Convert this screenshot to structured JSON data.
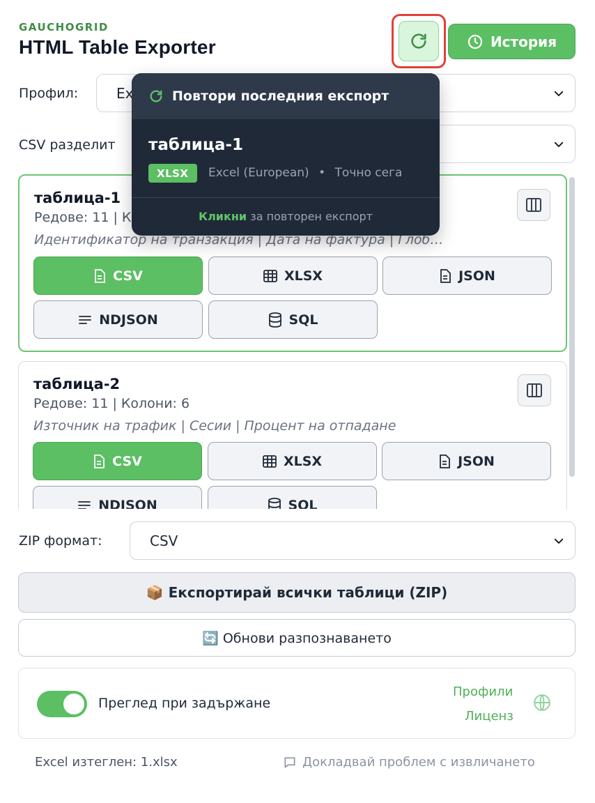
{
  "header": {
    "brand": "GAUCHOGRID",
    "title": "HTML Table Exporter",
    "history_label": "История"
  },
  "form": {
    "profile_label": "Профил:",
    "profile_value": "Ex",
    "csv_sep_label": "CSV разделит"
  },
  "tables": [
    {
      "name": "таблица-1",
      "meta": "Редове: 11 | К",
      "columns": "Идентификатор на транзакция | Дата на фактура | Глоб…"
    },
    {
      "name": "таблица-2",
      "meta": "Редове: 11 | Колони: 6",
      "columns": "Източник на трафик | Сесии | Процент на отпадане"
    }
  ],
  "formats": {
    "csv": "CSV",
    "xlsx": "XLSX",
    "json": "JSON",
    "ndjson": "NDJSON",
    "sql": "SQL"
  },
  "zip": {
    "label": "ZIP формат:",
    "value": "CSV",
    "export_all": "📦 Експортирай всички таблици (ZIP)"
  },
  "refresh_detection": "🔄 Обнови разпознаването",
  "settings": {
    "hover_preview": "Преглед при задържане",
    "hover_preview_enabled": true,
    "profiles_link": "Профили",
    "license_link": "Лиценз"
  },
  "footer": {
    "last_download": "Excel изтеглен: 1.xlsx",
    "report_issue": "Докладвай проблем с извличането"
  },
  "popover": {
    "title": "Повтори последния експорт",
    "table_name": "таблица-1",
    "format_badge": "XLSX",
    "format_variant": "Excel (European)",
    "separator": "•",
    "time": "Точно сега",
    "footer_em": "Кликни",
    "footer_rest": " за повторен експорт"
  },
  "colors": {
    "accent": "#5cbf63",
    "highlight": "#e0413a",
    "popover_bg": "#1f2937"
  }
}
